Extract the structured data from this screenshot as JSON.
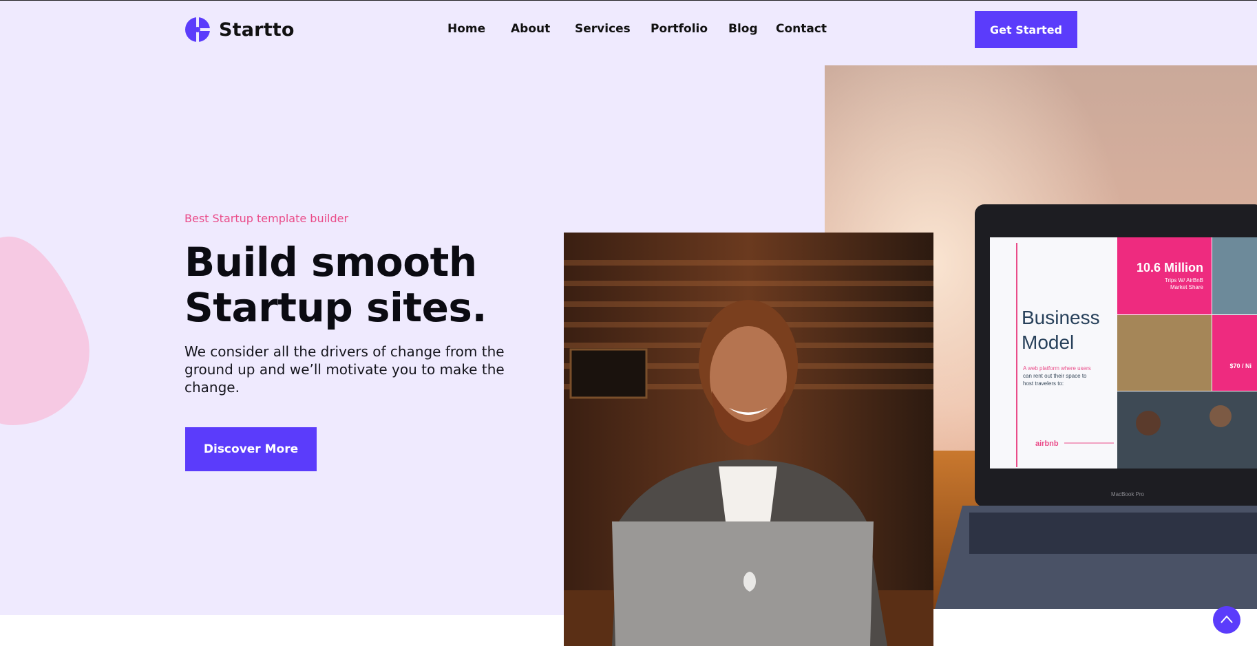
{
  "brand": {
    "name": "Startto",
    "accent": "#5b3cfb",
    "pink": "#ea4c89",
    "hero_bg": "#efeafe"
  },
  "nav": {
    "items": [
      {
        "label": "Home"
      },
      {
        "label": "About"
      },
      {
        "label": "Services"
      },
      {
        "label": "Portfolio"
      },
      {
        "label": "Blog"
      },
      {
        "label": "Contact"
      }
    ],
    "cta_label": "Get Started"
  },
  "hero": {
    "tagline": "Best Startup template builder",
    "headline_line1": "Build smooth",
    "headline_line2": "Startup sites.",
    "description": "We consider all the drivers of change from the ground up and we’ll motivate you to make the change.",
    "cta_label": "Discover More"
  },
  "laptop_screen": {
    "stat_value": "10.6 Million",
    "stat_caption_1": "Trips W/ AirBnB",
    "stat_caption_2": "Market Share",
    "title_line1": "Business",
    "title_line2": "Model",
    "body_line1": "A web platform where users",
    "body_line2": "can rent out their space to",
    "body_line3": "host travelers to:",
    "price_fragment": "$70 / Ni",
    "brand_mark": "airbnb",
    "device_label": "MacBook Pro"
  },
  "icons": {
    "logo": "logo-mark-icon",
    "scroll_top": "chevron-up-icon"
  }
}
